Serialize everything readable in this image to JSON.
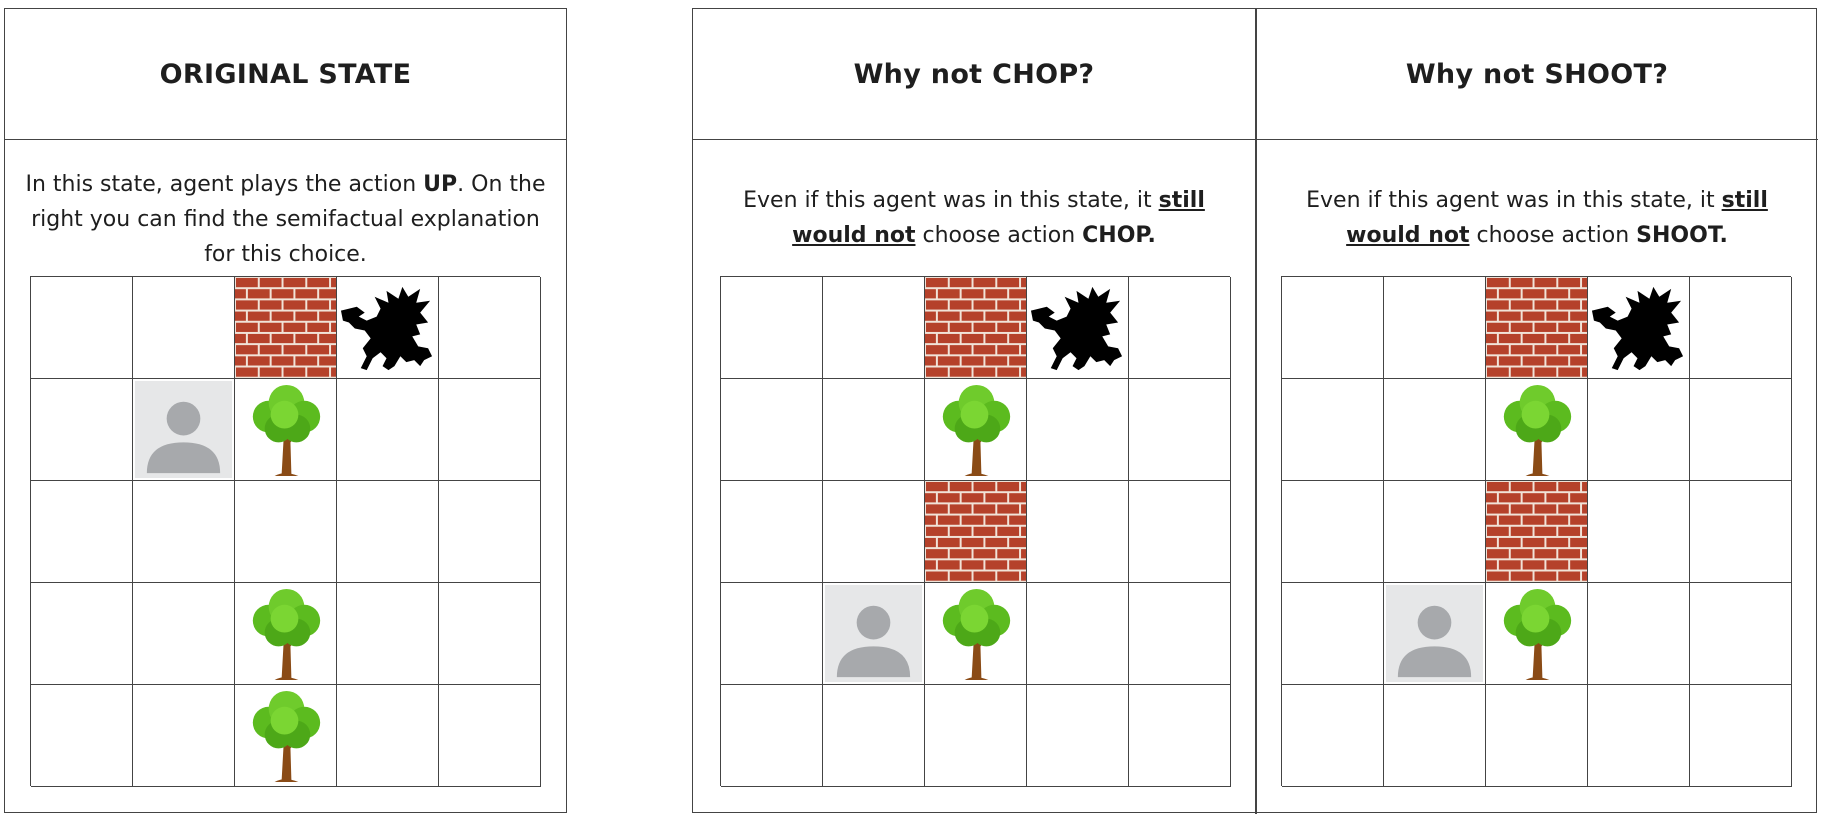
{
  "panels": [
    {
      "id": "original",
      "title": "ORIGINAL STATE",
      "description": [
        {
          "t": "In this state, agent plays the action "
        },
        {
          "t": "UP",
          "b": true
        },
        {
          "t": ". On the right you can find the semifactual explanation for this choice."
        }
      ],
      "grid": [
        [
          "empty",
          "empty",
          "wall",
          "dragon",
          "empty"
        ],
        [
          "empty",
          "agent",
          "tree",
          "empty",
          "empty"
        ],
        [
          "empty",
          "empty",
          "empty",
          "empty",
          "empty"
        ],
        [
          "empty",
          "empty",
          "tree",
          "empty",
          "empty"
        ],
        [
          "empty",
          "empty",
          "tree",
          "empty",
          "empty"
        ]
      ]
    },
    {
      "id": "why-not-chop",
      "title": "Why not CHOP?",
      "description": [
        {
          "t": "Even if this agent was in this state, it "
        },
        {
          "t": "still would not",
          "b": true,
          "u": true
        },
        {
          "t": " choose action "
        },
        {
          "t": "CHOP.",
          "b": true
        }
      ],
      "grid": [
        [
          "empty",
          "empty",
          "wall",
          "dragon",
          "empty"
        ],
        [
          "empty",
          "empty",
          "tree",
          "empty",
          "empty"
        ],
        [
          "empty",
          "empty",
          "wall",
          "empty",
          "empty"
        ],
        [
          "empty",
          "agent",
          "tree",
          "empty",
          "empty"
        ],
        [
          "empty",
          "empty",
          "empty",
          "empty",
          "empty"
        ]
      ]
    },
    {
      "id": "why-not-shoot",
      "title": "Why not SHOOT?",
      "description": [
        {
          "t": "Even if this agent was in this state, it "
        },
        {
          "t": "still would not",
          "b": true,
          "u": true
        },
        {
          "t": " choose action "
        },
        {
          "t": "SHOOT.",
          "b": true
        }
      ],
      "grid": [
        [
          "empty",
          "empty",
          "wall",
          "dragon",
          "empty"
        ],
        [
          "empty",
          "empty",
          "tree",
          "empty",
          "empty"
        ],
        [
          "empty",
          "empty",
          "wall",
          "empty",
          "empty"
        ],
        [
          "empty",
          "agent",
          "tree",
          "empty",
          "empty"
        ],
        [
          "empty",
          "empty",
          "empty",
          "empty",
          "empty"
        ]
      ]
    }
  ],
  "icons": {
    "agent": "person-avatar-icon",
    "wall": "brick-wall-icon",
    "tree": "tree-icon",
    "dragon": "dragon-silhouette-icon"
  },
  "colors": {
    "brick": "#b5412a",
    "mortar": "#f1e3d8",
    "leaf": "#5cbb1f",
    "trunk": "#8a4b16",
    "agent_bg": "#e6e7e8",
    "agent_fg": "#a7a9ac",
    "dragon": "#000000",
    "border": "#444444"
  }
}
